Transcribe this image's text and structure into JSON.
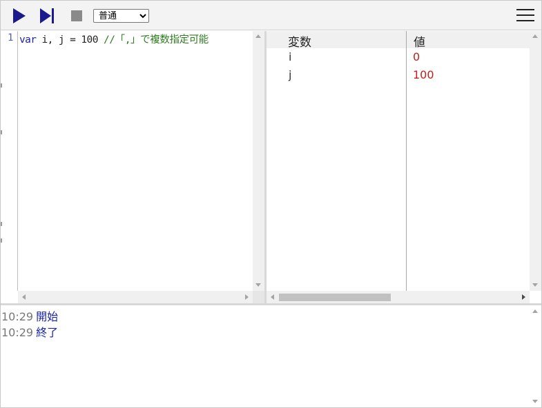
{
  "toolbar": {
    "play_icon": "play-icon",
    "step_icon": "step-forward-icon",
    "stop_icon": "stop-icon",
    "speed_selected": "普通",
    "menu_icon": "hamburger-menu-icon"
  },
  "editor": {
    "line_number": "1",
    "code": {
      "keyword": "var",
      "plain": " i, j = 100 ",
      "comment": "//「,」で複数指定可能"
    }
  },
  "variables": {
    "header_name": "変数",
    "header_value": "値",
    "rows": [
      {
        "name": "i",
        "value": "0"
      },
      {
        "name": "j",
        "value": "100"
      }
    ]
  },
  "log": [
    {
      "time": "10:29",
      "message": "開始"
    },
    {
      "time": "10:29",
      "message": "終了"
    }
  ],
  "colors": {
    "accent": "#1a1a8c",
    "keyword": "#1a22a8",
    "comment": "#2e7d1f",
    "value": "#c0201c"
  }
}
